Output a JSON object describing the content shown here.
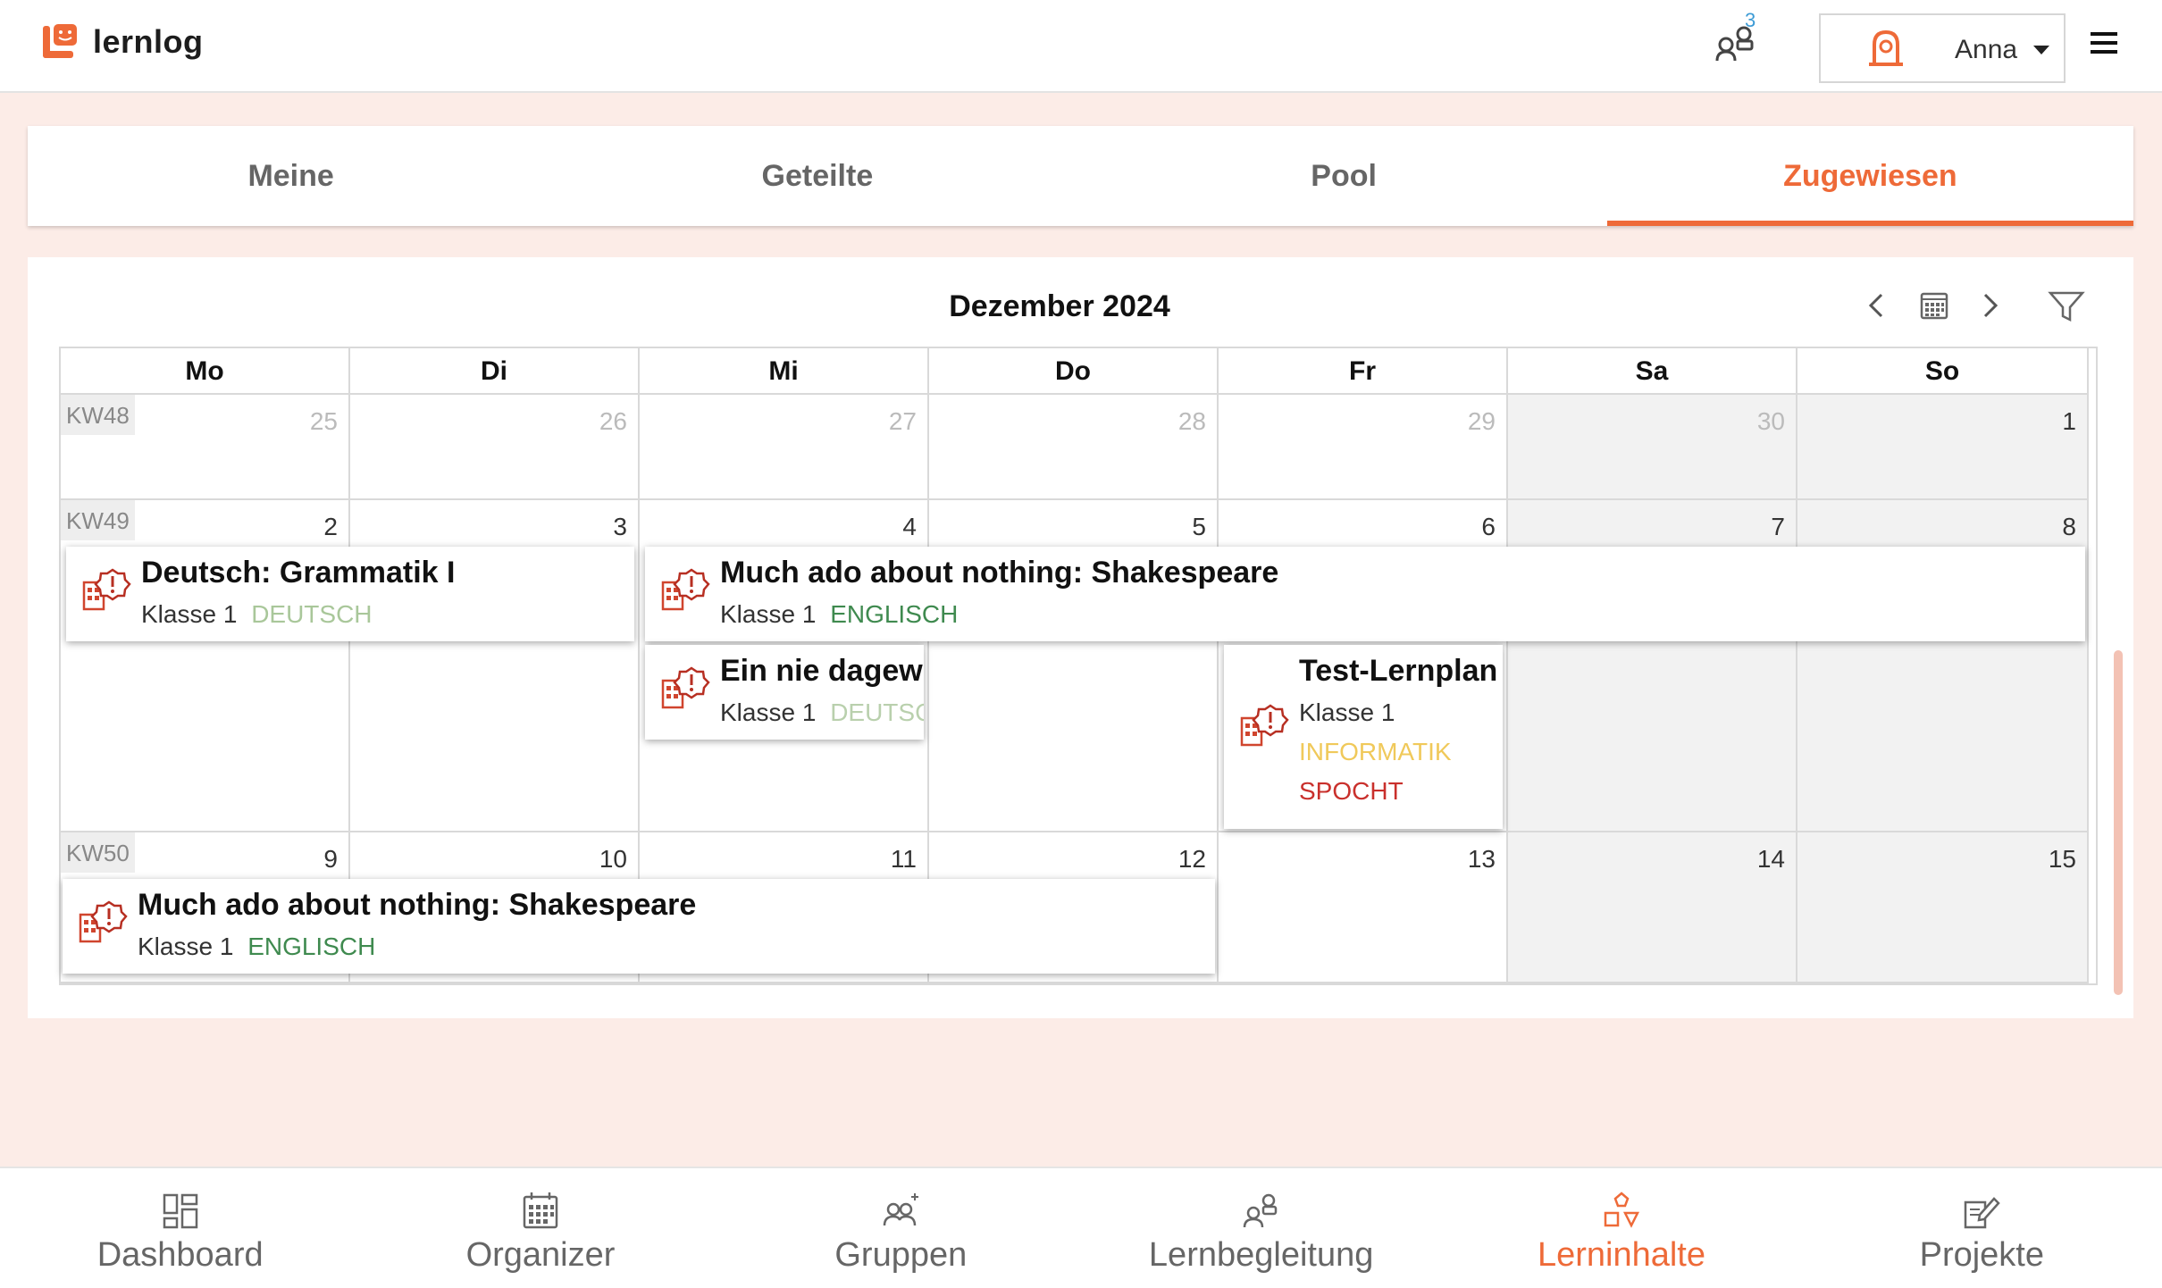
{
  "header": {
    "logo_text": "lernlog",
    "notification_count": "3",
    "user_name": "Anna"
  },
  "tabs": [
    {
      "label": "Meine",
      "active": false
    },
    {
      "label": "Geteilte",
      "active": false
    },
    {
      "label": "Pool",
      "active": false
    },
    {
      "label": "Zugewiesen",
      "active": true
    }
  ],
  "calendar": {
    "title": "Dezember 2024",
    "weekdays": [
      "Mo",
      "Di",
      "Mi",
      "Do",
      "Fr",
      "Sa",
      "So"
    ],
    "weeks": [
      {
        "kw": "KW48",
        "days": [
          "25",
          "26",
          "27",
          "28",
          "29",
          "30",
          "1"
        ]
      },
      {
        "kw": "KW49",
        "days": [
          "2",
          "3",
          "4",
          "5",
          "6",
          "7",
          "8"
        ]
      },
      {
        "kw": "KW50",
        "days": [
          "9",
          "10",
          "11",
          "12",
          "13",
          "14",
          "15"
        ]
      }
    ],
    "events": [
      {
        "title": "Deutsch: Grammatik I",
        "class": "Klasse 1",
        "tags": [
          {
            "label": "DEUTSCH",
            "color": "#a9c79a"
          }
        ]
      },
      {
        "title": "Much ado about nothing: Shakespeare",
        "class": "Klasse 1",
        "tags": [
          {
            "label": "ENGLISCH",
            "color": "#3f8a4f"
          }
        ]
      },
      {
        "title": "Ein nie dagewe",
        "class": "Klasse 1",
        "tags": [
          {
            "label": "DEUTSCH",
            "color": "#b9d0ad"
          }
        ]
      },
      {
        "title": "Test-Lernplan",
        "class": "Klasse 1",
        "tags": [
          {
            "label": "INFORMATIK",
            "color": "#f0c95a"
          },
          {
            "label": "SPOCHT",
            "color": "#c9302c"
          }
        ]
      },
      {
        "title": "Much ado about nothing: Shakespeare",
        "class": "Klasse 1",
        "tags": [
          {
            "label": "ENGLISCH",
            "color": "#3f8a4f"
          }
        ]
      }
    ]
  },
  "bottom_nav": [
    {
      "label": "Dashboard",
      "icon": "dashboard-icon",
      "active": false
    },
    {
      "label": "Organizer",
      "icon": "calendar-icon",
      "active": false
    },
    {
      "label": "Gruppen",
      "icon": "groups-icon",
      "active": false
    },
    {
      "label": "Lernbegleitung",
      "icon": "mentoring-icon",
      "active": false
    },
    {
      "label": "Lerninhalte",
      "icon": "learning-content-icon",
      "active": true
    },
    {
      "label": "Projekte",
      "icon": "projects-icon",
      "active": false
    }
  ],
  "colors": {
    "accent": "#ee6a38",
    "background": "#fcece7"
  }
}
